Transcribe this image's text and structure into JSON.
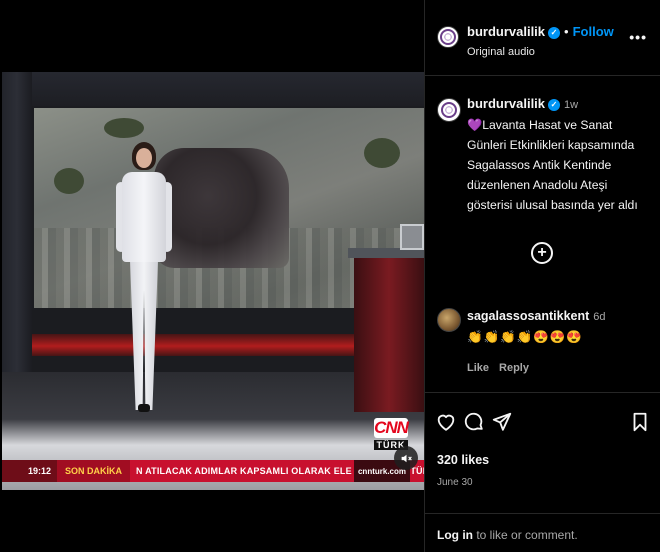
{
  "post": {
    "username": "burdurvalilik",
    "follow_label": "Follow",
    "separator": "•",
    "audio": "Original audio",
    "more_label": "•••"
  },
  "caption": {
    "username": "burdurvalilik",
    "time_ago": "1w",
    "heart": "💜",
    "text": "Lavanta Hasat ve Sanat Günleri Etkinlikleri kapsamında Sagalassos Antik Kentinde düzenlenen Anadolu Ateşi gösterisi ulusal basında yer aldı"
  },
  "load_more_label": "+",
  "comment": {
    "username": "sagalassosantikkent",
    "time_ago": "6d",
    "emojis": "👏👏👏👏😍😍😍",
    "like_label": "Like",
    "reply_label": "Reply"
  },
  "actions": {
    "likes": "320 likes",
    "date": "June 30",
    "login_link": "Log in",
    "login_rest": " to like or comment."
  },
  "video": {
    "ticker_time": "19:12",
    "ticker_label": "SON DAKİKA",
    "ticker_text": "N ATILACAK ADIMLAR KAPSAMLI OLARAK ELE ALINIRKEN, TÜRKİYE'NİN FİLİSTİN",
    "ticker_site": "cnnturk.com",
    "logo_top": "CNN",
    "logo_bottom": "TÜRK"
  },
  "colors": {
    "accent": "#0095f6",
    "background": "#000000",
    "muted_text": "#a8a8a8",
    "ticker_red": "#c8102e"
  },
  "icons": [
    "verified-badge-icon",
    "more-options-icon",
    "load-more-icon",
    "like-heart-icon",
    "comment-icon",
    "share-icon",
    "save-bookmark-icon",
    "mute-icon"
  ]
}
